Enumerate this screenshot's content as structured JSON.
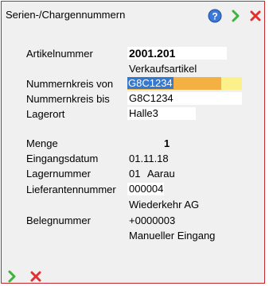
{
  "window": {
    "title": "Serien-/Chargennummern"
  },
  "toolbar": {
    "help_icon": "help-icon",
    "ok_icon": "chevron-right-icon",
    "close_icon": "close-icon"
  },
  "fields": {
    "artikelnummer": {
      "label": "Artikelnummer",
      "value": "2001.201",
      "sub": "Verkaufsartikel"
    },
    "nummernkreis_von": {
      "label": "Nummernkreis von",
      "value": "G8C1234"
    },
    "nummernkreis_bis": {
      "label": "Nummernkreis bis",
      "value": "G8C1234"
    },
    "lagerort": {
      "label": "Lagerort",
      "value": "Halle3"
    },
    "menge": {
      "label": "Menge",
      "value": "1"
    },
    "eingangsdatum": {
      "label": "Eingangsdatum",
      "value": "01.11.18"
    },
    "lagernummer": {
      "label": "Lagernummer",
      "number": "01",
      "name": "Aarau"
    },
    "lieferantennummer": {
      "label": "Lieferantennummer",
      "value": "000004",
      "name": "Wiederkehr AG"
    },
    "belegnummer": {
      "label": "Belegnummer",
      "value": "+0000003",
      "sub": "Manueller Eingang"
    }
  },
  "colors": {
    "border": "#c0282c",
    "selection": "#3478d0",
    "orange": "#f5b044",
    "yellow": "#fbf08a",
    "ok_green": "#3cb33c",
    "close_red": "#e03030",
    "help_blue": "#3c78d8"
  }
}
